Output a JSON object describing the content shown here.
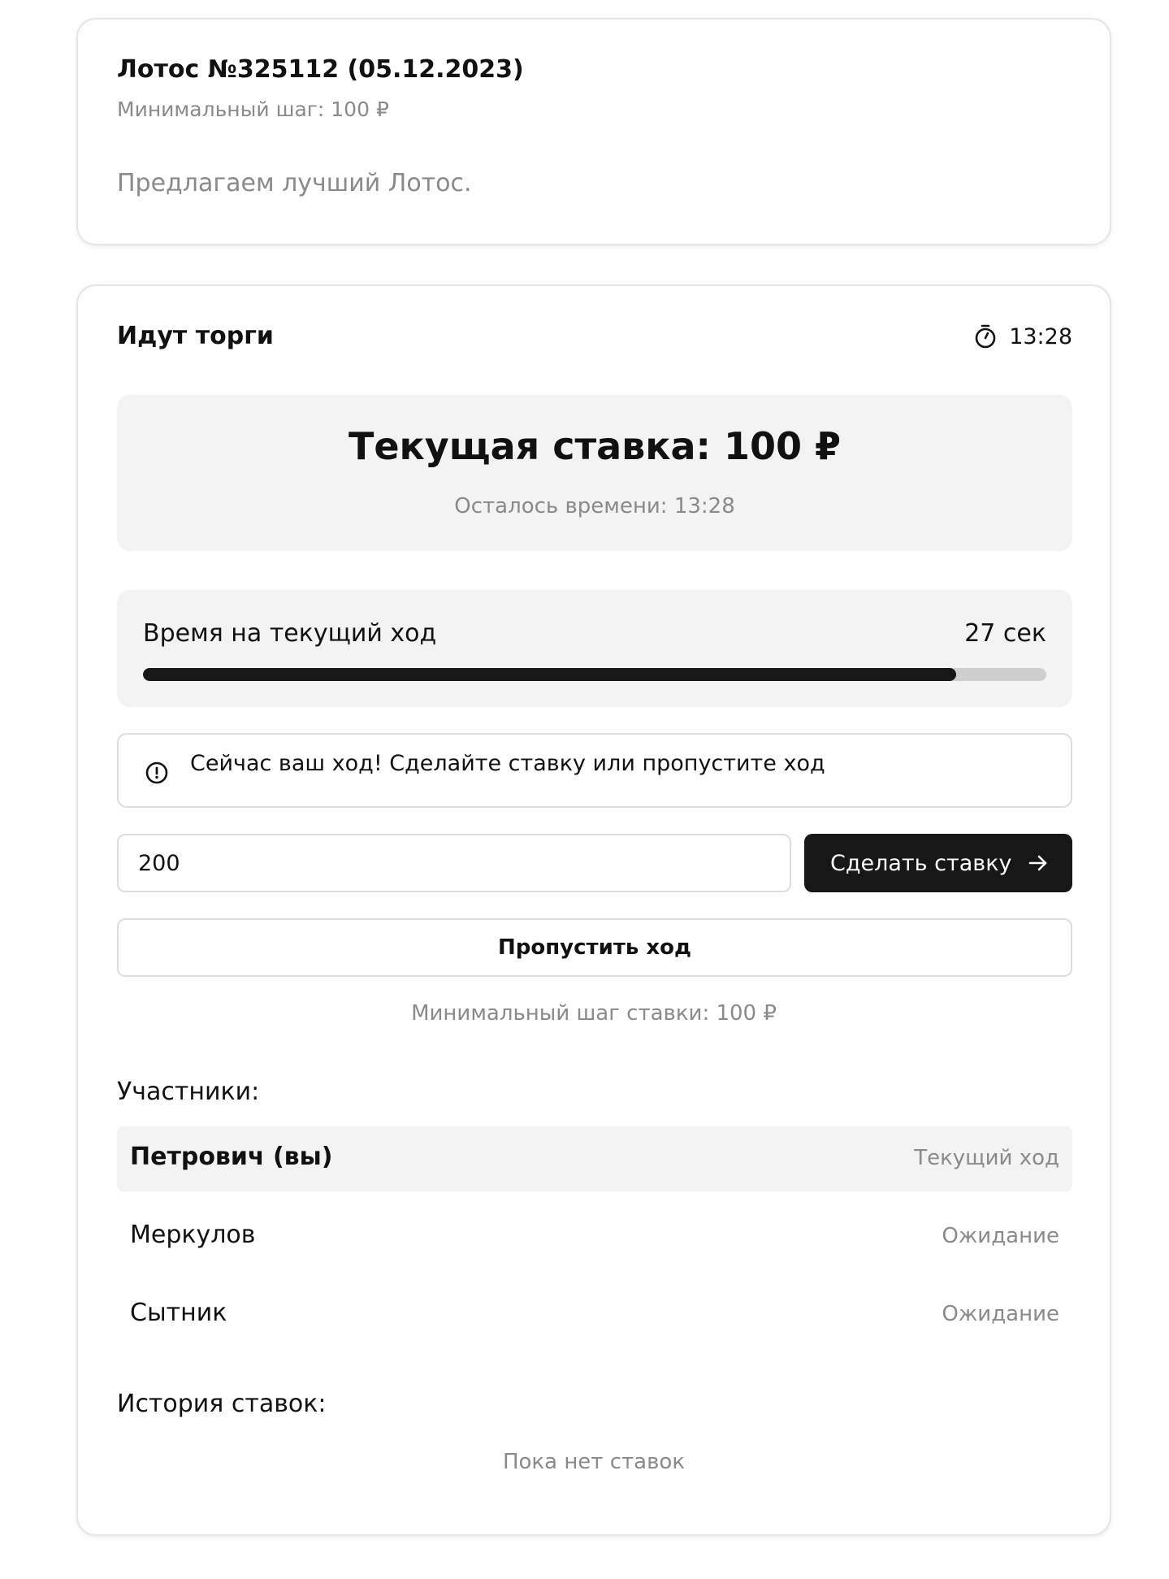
{
  "lot": {
    "title": "Лотос №325112 (05.12.2023)",
    "min_step": "Минимальный шаг: 100 ₽",
    "description": "Предлагаем лучший Лотос."
  },
  "auction": {
    "status": "Идут торги",
    "timer": "13:28",
    "timer_icon": "stopwatch-icon",
    "current_bid": "Текущая ставка: 100 ₽",
    "time_left": "Осталось времени: 13:28",
    "turn": {
      "label": "Время на текущий ход",
      "seconds": "27 сек",
      "progress": 0.9
    },
    "notice": {
      "icon": "alert-circle-icon",
      "text": "Сейчас ваш ход! Сделайте ставку или пропустите ход"
    },
    "bid_input": {
      "value": "200"
    },
    "bid_button": {
      "label": "Сделать ставку",
      "icon": "arrow-right-icon"
    },
    "skip_button": {
      "label": "Пропустить ход"
    },
    "min_bid_step": "Минимальный шаг ставки: 100 ₽",
    "participants_title": "Участники:",
    "participants": [
      {
        "name": "Петрович (вы)",
        "status": "Текущий ход"
      },
      {
        "name": "Меркулов",
        "status": "Ожидание"
      },
      {
        "name": "Сытник",
        "status": "Ожидание"
      }
    ],
    "history_title": "История ставок:",
    "history_empty": "Пока нет ставок"
  },
  "colors": {
    "accent": "#171717",
    "muted_text": "#8a8a8a",
    "panel_bg": "#f3f3f3",
    "border": "#dedede"
  }
}
